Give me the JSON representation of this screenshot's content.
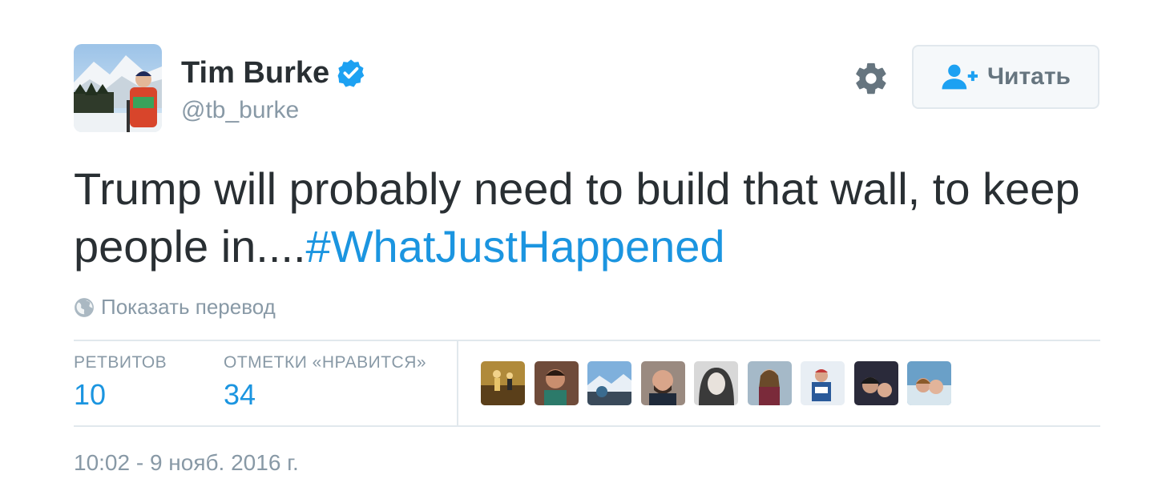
{
  "user": {
    "name": "Tim Burke",
    "handle": "@tb_burke",
    "verified_icon": "verified-badge-icon",
    "verified_color": "#1da1f2"
  },
  "header": {
    "gear_icon": "gear-icon",
    "follow_button": {
      "label": "Читать",
      "icon": "add-person-icon",
      "icon_color": "#1da1f2"
    }
  },
  "tweet": {
    "text_before": "Trump will probably need to build that wall, to keep people in....",
    "hashtag": "#WhatJustHappened",
    "hashtag_color": "#1b95e0"
  },
  "translate": {
    "icon": "globe-icon",
    "label": "Показать перевод"
  },
  "stats": {
    "retweets": {
      "label": "РЕТВИТОВ",
      "value": "10"
    },
    "likes": {
      "label": "ОТМЕТКИ «НРАВИТСЯ»",
      "value": "34"
    }
  },
  "likers_count_shown": 9,
  "timestamp": "10:02 - 9 нояб. 2016 г.",
  "colors": {
    "text": "#292f33",
    "muted": "#8899a6",
    "link": "#1b95e0",
    "divider": "#e1e8ed"
  }
}
